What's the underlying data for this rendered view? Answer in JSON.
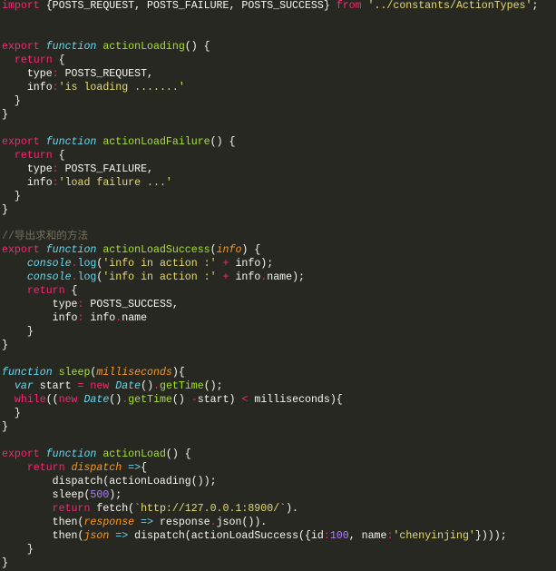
{
  "theme": {
    "background": "#272822",
    "foreground": "#F8F8F2"
  },
  "editor": {
    "lines": [
      [
        [
          "import",
          "#F92672"
        ],
        [
          " {POSTS_REQUEST, POSTS_FAILURE, POSTS_SUCCESS} "
        ],
        [
          "from",
          "#F92672"
        ],
        [
          " '../constants/ActionTypes'",
          "#E6DB74"
        ],
        [
          ";"
        ]
      ],
      [],
      [],
      [
        [
          "export",
          "#F92672"
        ],
        [
          " function",
          "#66D9EF",
          true
        ],
        [
          " actionLoading",
          "#A6E22E"
        ],
        [
          "() {"
        ]
      ],
      [
        [
          "  return",
          "#F92672"
        ],
        [
          " {"
        ]
      ],
      [
        [
          "    type"
        ],
        [
          ":",
          "#F92672"
        ],
        [
          " POSTS_REQUEST,"
        ]
      ],
      [
        [
          "    info"
        ],
        [
          ":",
          "#F92672"
        ],
        [
          "'is loading .......'",
          "#E6DB74"
        ]
      ],
      [
        [
          "  }"
        ]
      ],
      [
        [
          "}"
        ]
      ],
      [],
      [
        [
          "export",
          "#F92672"
        ],
        [
          " function",
          "#66D9EF",
          true
        ],
        [
          " actionLoadFailure",
          "#A6E22E"
        ],
        [
          "() {"
        ]
      ],
      [
        [
          "  return",
          "#F92672"
        ],
        [
          " {"
        ]
      ],
      [
        [
          "    type"
        ],
        [
          ":",
          "#F92672"
        ],
        [
          " POSTS_FAILURE,"
        ]
      ],
      [
        [
          "    info"
        ],
        [
          ":",
          "#F92672"
        ],
        [
          "'load failure ...'",
          "#E6DB74"
        ]
      ],
      [
        [
          "  }"
        ]
      ],
      [
        [
          "}"
        ]
      ],
      [],
      [
        [
          "//导出求和的方法",
          "#75715E"
        ]
      ],
      [
        [
          "export",
          "#F92672"
        ],
        [
          " function",
          "#66D9EF",
          true
        ],
        [
          " actionLoadSuccess",
          "#A6E22E"
        ],
        [
          "("
        ],
        [
          "info",
          "#FD971F",
          true
        ],
        [
          ") {"
        ]
      ],
      [
        [
          "    console",
          "#66D9EF",
          true
        ],
        [
          ".",
          "#F92672"
        ],
        [
          "log",
          "#66D9EF"
        ],
        [
          "("
        ],
        [
          "'info in action :'",
          "#E6DB74"
        ],
        [
          " +",
          "#F92672"
        ],
        [
          " info);"
        ]
      ],
      [
        [
          "    console",
          "#66D9EF",
          true
        ],
        [
          ".",
          "#F92672"
        ],
        [
          "log",
          "#66D9EF"
        ],
        [
          "("
        ],
        [
          "'info in action :'",
          "#E6DB74"
        ],
        [
          " +",
          "#F92672"
        ],
        [
          " info"
        ],
        [
          ".",
          "#F92672"
        ],
        [
          "name);"
        ]
      ],
      [
        [
          "    return",
          "#F92672"
        ],
        [
          " {"
        ]
      ],
      [
        [
          "        type"
        ],
        [
          ":",
          "#F92672"
        ],
        [
          " POSTS_SUCCESS,"
        ]
      ],
      [
        [
          "        info"
        ],
        [
          ":",
          "#F92672"
        ],
        [
          " info"
        ],
        [
          ".",
          "#F92672"
        ],
        [
          "name"
        ]
      ],
      [
        [
          "    }"
        ]
      ],
      [
        [
          "}"
        ]
      ],
      [],
      [
        [
          "function",
          "#66D9EF",
          true
        ],
        [
          " sleep",
          "#A6E22E"
        ],
        [
          "("
        ],
        [
          "milliseconds",
          "#FD971F",
          true
        ],
        [
          "){"
        ]
      ],
      [
        [
          "  var",
          "#66D9EF",
          true
        ],
        [
          " start "
        ],
        [
          "=",
          "#F92672"
        ],
        [
          " new",
          "#F92672"
        ],
        [
          " Date",
          "#66D9EF",
          true
        ],
        [
          "()"
        ],
        [
          ".",
          "#F92672"
        ],
        [
          "getTime",
          "#A6E22E"
        ],
        [
          "();"
        ]
      ],
      [
        [
          "  while",
          "#F92672"
        ],
        [
          "(("
        ],
        [
          "new",
          "#F92672"
        ],
        [
          " Date",
          "#66D9EF",
          true
        ],
        [
          "()"
        ],
        [
          ".",
          "#F92672"
        ],
        [
          "getTime",
          "#A6E22E"
        ],
        [
          "() "
        ],
        [
          "-",
          "#F92672"
        ],
        [
          "start) "
        ],
        [
          "<",
          "#F92672"
        ],
        [
          " milliseconds){"
        ]
      ],
      [
        [
          "  }"
        ]
      ],
      [
        [
          "}"
        ]
      ],
      [],
      [
        [
          "export",
          "#F92672"
        ],
        [
          " function",
          "#66D9EF",
          true
        ],
        [
          " actionLoad",
          "#A6E22E"
        ],
        [
          "() {"
        ]
      ],
      [
        [
          "    return",
          "#F92672"
        ],
        [
          " dispatch",
          "#FD971F",
          true
        ],
        [
          " =>",
          "#66D9EF"
        ],
        [
          "{"
        ]
      ],
      [
        [
          "        dispatch(actionLoading());"
        ]
      ],
      [
        [
          "        sleep("
        ],
        [
          "500",
          "#AE81FF"
        ],
        [
          ");"
        ]
      ],
      [
        [
          "        return",
          "#F92672"
        ],
        [
          " fetch("
        ],
        [
          "`http://127.0.0.1:8900/`",
          "#E6DB74"
        ],
        [
          ")."
        ]
      ],
      [
        [
          "        then("
        ],
        [
          "response",
          "#FD971F",
          true
        ],
        [
          " =>",
          "#66D9EF"
        ],
        [
          " response"
        ],
        [
          ".",
          "#F92672"
        ],
        [
          "json"
        ],
        [
          "())."
        ]
      ],
      [
        [
          "        then("
        ],
        [
          "json",
          "#FD971F",
          true
        ],
        [
          " =>",
          "#66D9EF"
        ],
        [
          " dispatch(actionLoadSuccess({id"
        ],
        [
          ":",
          "#F92672"
        ],
        [
          "100",
          "#AE81FF"
        ],
        [
          ", name"
        ],
        [
          ":",
          "#F92672"
        ],
        [
          "'chenyinjing'",
          "#E6DB74"
        ],
        [
          "})));"
        ]
      ],
      [
        [
          "    }"
        ]
      ],
      [
        [
          "}"
        ]
      ]
    ]
  }
}
